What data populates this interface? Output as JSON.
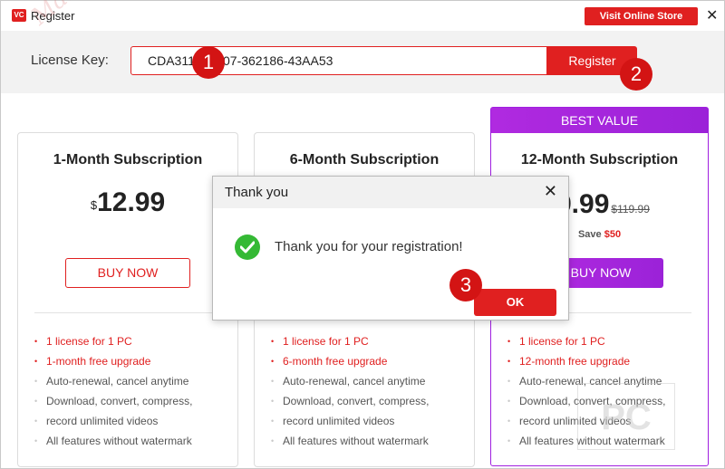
{
  "window": {
    "title": "Register",
    "logo_text": "VC",
    "store_button": "Visit Online Store",
    "close_glyph": "✕"
  },
  "license": {
    "label": "License Key:",
    "value": "CDA311        07-362186-43AA53",
    "register_button": "Register"
  },
  "cards": [
    {
      "title": "1-Month Subscription",
      "currency": "$",
      "price": "12.99",
      "buy_label": "BUY NOW",
      "features": [
        "1 license for 1 PC",
        "1-month free upgrade",
        "Auto-renewal, cancel anytime",
        "Download, convert, compress,",
        "record unlimited videos",
        "All features without watermark"
      ]
    },
    {
      "title": "6-Month Subscription",
      "features": [
        "1 license for 1 PC",
        "6-month free upgrade",
        "Auto-renewal, cancel anytime",
        "Download, convert, compress,",
        "record unlimited videos",
        "All features without watermark"
      ]
    },
    {
      "badge": "BEST VALUE",
      "title": "12-Month Subscription",
      "price": "9.99",
      "old_price": "$119.99",
      "save_label": "Save",
      "save_amount": "$50",
      "buy_label": "BUY NOW",
      "features": [
        "1 license for 1 PC",
        "12-month free upgrade",
        "Auto-renewal, cancel anytime",
        "Download, convert, compress,",
        "record unlimited videos",
        "All features without watermark"
      ]
    }
  ],
  "dialog": {
    "title": "Thank you",
    "close_glyph": "✕",
    "message": "Thank you for your registration!",
    "ok_button": "OK"
  },
  "markers": [
    "1",
    "2",
    "3"
  ],
  "watermarks": {
    "script": "Mamo PC",
    "badge": "PC"
  },
  "colors": {
    "accent_red": "#e02020",
    "accent_purple": "#a020e0",
    "success_green": "#35b935"
  }
}
